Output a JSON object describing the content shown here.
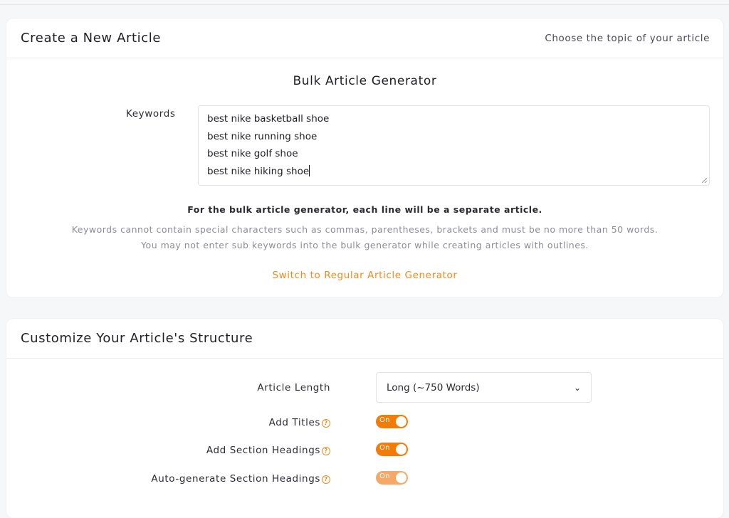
{
  "create_card": {
    "title": "Create a New Article",
    "subtitle": "Choose the topic of your article",
    "section_title": "Bulk Article Generator",
    "keywords_label": "Keywords",
    "keywords_lines": [
      "best nike basketball shoe",
      "best nike running shoe",
      "best nike golf shoe",
      "best nike hiking shoe"
    ],
    "note_bold": "For the bulk article generator, each line will be a separate article.",
    "note_line1": "Keywords cannot contain special characters such as commas, parentheses, brackets and must be no more than 50 words.",
    "note_line2": "You may not enter sub keywords into the bulk generator while creating articles with outlines.",
    "switch_link": "Switch to Regular Article Generator"
  },
  "structure_card": {
    "title": "Customize Your Article's Structure",
    "article_length_label": "Article Length",
    "article_length_value": "Long (~750 Words)",
    "rows": [
      {
        "label": "Add Titles",
        "toggle_text": "On",
        "state": "on"
      },
      {
        "label": "Add Section Headings",
        "toggle_text": "On",
        "state": "on"
      },
      {
        "label": "Auto-generate Section Headings",
        "toggle_text": "On",
        "state": "on-disabled"
      }
    ]
  },
  "colors": {
    "accent": "#f47b06",
    "accent_disabled": "#f7a867",
    "link": "#f08a1c"
  },
  "icons": {
    "help": "question-circle-icon",
    "select_arrow": "chevron-down-icon"
  }
}
